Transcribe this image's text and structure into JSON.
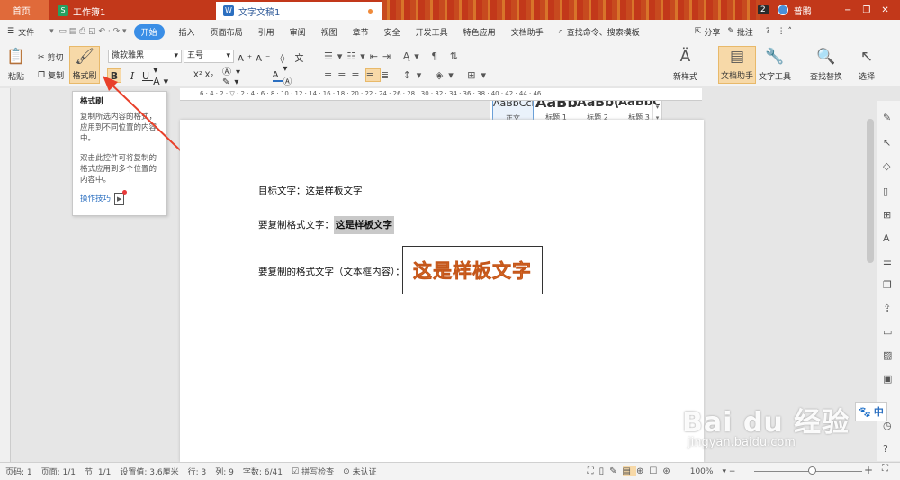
{
  "tabs": {
    "home": "首页",
    "sheet": "工作簿1",
    "doc": "文字文稿1",
    "count": "2",
    "user": "普鹏"
  },
  "menu": {
    "file": "文件",
    "items": [
      "开始",
      "插入",
      "页面布局",
      "引用",
      "审阅",
      "视图",
      "章节",
      "安全",
      "开发工具",
      "特色应用",
      "文档助手"
    ],
    "search": "查找命令、搜索模板",
    "share": "分享",
    "comment": "批注"
  },
  "ribbon": {
    "paste": "粘贴",
    "cut": "剪切",
    "copy": "复制",
    "format_painter": "格式刷",
    "font_name": "微软雅黑",
    "font_size": "五号",
    "styles": [
      {
        "preview": "AaBbCcDd",
        "name": "正文"
      },
      {
        "preview": "AaBb",
        "name": "标题 1"
      },
      {
        "preview": "AaBb(",
        "name": "标题 2"
      },
      {
        "preview": "AaBbC",
        "name": "标题 3"
      }
    ],
    "new_style": "新样式",
    "doc_assistant": "文档助手",
    "text_tools": "文字工具",
    "find_replace": "查找替换",
    "select": "选择"
  },
  "tooltip": {
    "title": "格式刷",
    "para1": "复制所选内容的格式，应用到不同位置的内容中。",
    "para2": "双击此控件可将复制的格式应用到多个位置的内容中。",
    "link": "操作技巧"
  },
  "document": {
    "line1": "目标文字：这是样板文字",
    "line2_label": "要复制格式文字：",
    "line2_value": "这是样板文字",
    "line3_label": "要复制的格式文字（文本框内容）：",
    "textbox": "这是样板文字"
  },
  "status": {
    "page_num": "页码: 1",
    "pages": "页面: 1/1",
    "section": "节: 1/1",
    "setting": "设置值: 3.6厘米",
    "row": "行: 3",
    "col": "列: 9",
    "words": "字数: 6/41",
    "spell": "拼写检查",
    "cert": "未认证",
    "zoom": "100%"
  },
  "watermark": {
    "logo": "Bai du 经验",
    "url": "jingyan.baidu.com"
  },
  "ime": "中",
  "colors": {
    "accent": "#3a8ee6",
    "title_bar": "#c2381a",
    "arrow": "#e8402a"
  }
}
